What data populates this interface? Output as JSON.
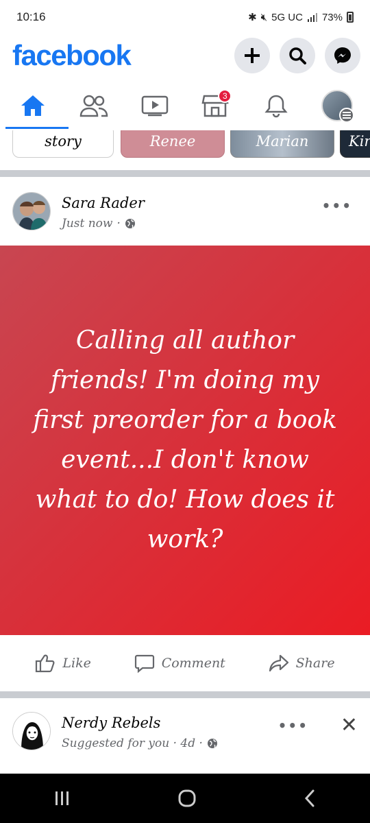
{
  "status_bar": {
    "time": "10:16",
    "network": "5G UC",
    "battery": "73%"
  },
  "header": {
    "logo": "facebook"
  },
  "stories": [
    {
      "label": "story"
    },
    {
      "label": "Renee"
    },
    {
      "label": "Marian"
    },
    {
      "label": "Kir"
    }
  ],
  "nav": {
    "marketplace_badge": "3"
  },
  "post": {
    "author": "Sara Rader",
    "time": "Just now",
    "separator": "·",
    "text": "Calling all author friends! I'm doing my first preorder for a book event...I don't know what to do! How does it work?",
    "background_start": "#c84651",
    "background_end": "#ea1c24",
    "actions": {
      "like": "Like",
      "comment": "Comment",
      "share": "Share"
    }
  },
  "suggested_post": {
    "author": "Nerdy Rebels",
    "meta": "Suggested for you · 4d ·"
  },
  "colors": {
    "brand": "#1877f2",
    "badge": "#e41e3f"
  }
}
